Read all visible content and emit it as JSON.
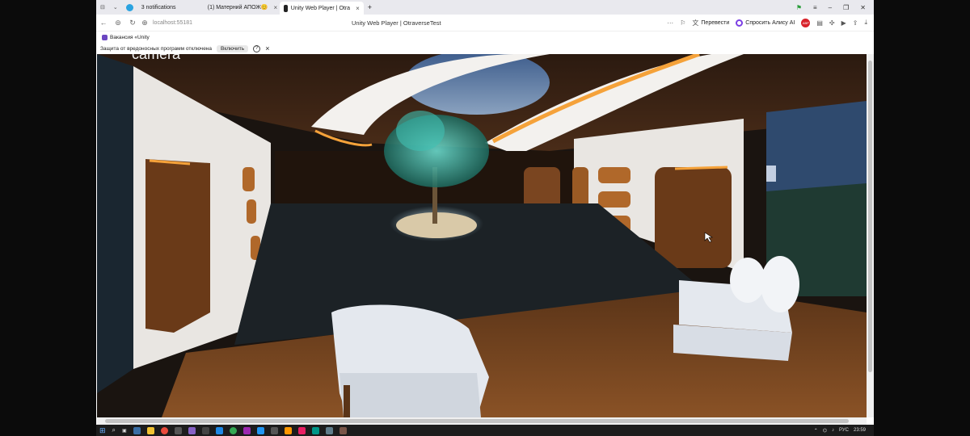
{
  "tabs": [
    {
      "label": "3 notifications",
      "active": false
    },
    {
      "label": "(1) Матерний АПОЖ😊",
      "active": false
    },
    {
      "label": "Unity Web Player | Otra",
      "active": true
    }
  ],
  "address": {
    "url": "localhost:55181",
    "page_title": "Unity Web Player | OtraverseTest",
    "translate_label": "Перевести",
    "alice_label": "Спросить Алису AI"
  },
  "bookmarks": [
    {
      "label": "Вакансия «Unity"
    }
  ],
  "infobar": {
    "message": "Защита от вредоносных программ отключена",
    "enable_label": "Включить",
    "help_icon": "?",
    "close_icon": "×"
  },
  "unity": {
    "overlay_text": "camera"
  },
  "taskbar": {
    "lang": "РУС",
    "time": "23:59"
  },
  "colors": {
    "tab_bar_bg": "#e9e9ee",
    "taskbar_bg": "#1c1c1c",
    "accent_alice": "#7b3fe4"
  }
}
